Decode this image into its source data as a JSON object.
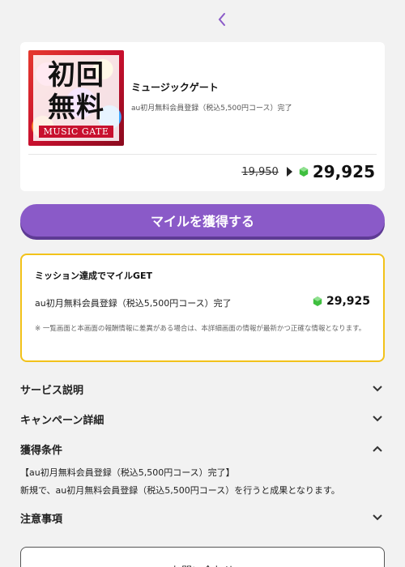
{
  "nav": {
    "back_icon": "chevron-left-icon"
  },
  "offer": {
    "thumbnail": {
      "line1": "初回",
      "line2": "無料",
      "logo_text": "MUSIC GATE"
    },
    "title": "ミュージックゲート",
    "subtitle": "au初月無料会員登録（税込5,500円コース）完了",
    "price_old": "19,950",
    "price_new": "29,925"
  },
  "cta": {
    "label": "マイルを獲得する"
  },
  "mission": {
    "title": "ミッション達成でマイルGET",
    "desc": "au初月無料会員登録（税込5,500円コース）完了",
    "points": "29,925",
    "note": "※ 一覧画面と本画面の報酬情報に差異がある場合は、本詳細画面の情報が最新かつ正確な情報となります。"
  },
  "sections": {
    "service": "サービス説明",
    "campaign": "キャンペーン詳細",
    "conditions": "獲得条件",
    "conditions_line1": "【au初月無料会員登録（税込5,500円コース）完了】",
    "conditions_line2": "新規で、au初月無料会員登録（税込5,500円コース）を行うと成果となります。",
    "notes": "注意事項"
  },
  "contact": {
    "label": "お問い合わせ"
  },
  "colors": {
    "accent": "#8a5ac8",
    "mission_border": "#f2c21a",
    "gem": "#3fbf3f"
  }
}
